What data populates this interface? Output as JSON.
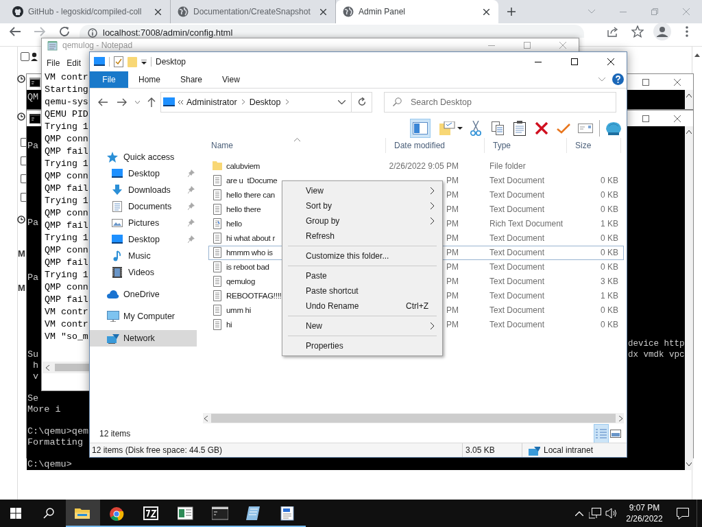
{
  "browser": {
    "tabs": [
      {
        "title": "GitHub - legoskid/compiled-coll",
        "selected": false
      },
      {
        "title": "Documentation/CreateSnapshot",
        "selected": false
      },
      {
        "title": "Admin Panel",
        "selected": true
      }
    ],
    "url": "localhost:7008/admin/config.html",
    "page_letters": [
      "M",
      "M"
    ],
    "checkboxes": [
      {
        "checked": false
      },
      {
        "checked": false
      },
      {
        "checked": false
      },
      {
        "checked": false
      },
      {
        "checked": false
      }
    ]
  },
  "console_back": {
    "lines": [
      "QM"
    ]
  },
  "console_front": {
    "groups": [
      [
        "Pa"
      ],
      [
        "Pa"
      ],
      [
        "Pa"
      ],
      [
        "Su",
        " h",
        " v"
      ],
      [
        "Se",
        "More i"
      ],
      [
        "C:\\qemu>qem",
        "Formatting"
      ],
      [
        "C:\\qemu>"
      ]
    ],
    "tails": [
      "device http",
      "dx vmdk vpc"
    ]
  },
  "notepad": {
    "title": "qemulog - Notepad",
    "menu": [
      "File",
      "Edit"
    ],
    "lines": [
      "VM contr",
      "Starting",
      "qemu-sys",
      "QEMU PID",
      "Trying 1",
      "QMP conn",
      "QMP fail",
      "Trying 1",
      "QMP conn",
      "QMP fail",
      "Trying 1",
      "QMP conn",
      "QMP fail",
      "Trying 1",
      "QMP conn",
      "QMP fail",
      "Trying 1",
      "QMP conn",
      "QMP fail",
      "VM contr",
      "VM contr",
      "VM \"so_m"
    ]
  },
  "explorer": {
    "title": "Desktop",
    "ribbon_tabs": [
      {
        "label": "File",
        "kind": "file"
      },
      {
        "label": "Home",
        "kind": "tab"
      },
      {
        "label": "Share",
        "kind": "tab"
      },
      {
        "label": "View",
        "kind": "tab"
      }
    ],
    "path": [
      "Administrator",
      "Desktop"
    ],
    "search": {
      "placeholder": "Search Desktop"
    },
    "nav": [
      {
        "label": "Quick access",
        "kind": "star",
        "selected": false,
        "children": [
          {
            "label": "Desktop",
            "kind": "desktop",
            "pinned": true,
            "selected": false
          },
          {
            "label": "Downloads",
            "kind": "downloads",
            "pinned": true,
            "selected": false
          },
          {
            "label": "Documents",
            "kind": "documents",
            "pinned": true,
            "selected": false
          },
          {
            "label": "Pictures",
            "kind": "pictures",
            "pinned": true,
            "selected": false
          },
          {
            "label": "Desktop",
            "kind": "desktop",
            "pinned": true,
            "selected": false
          },
          {
            "label": "Music",
            "kind": "music",
            "pinned": false,
            "selected": false
          },
          {
            "label": "Videos",
            "kind": "videos",
            "pinned": false,
            "selected": false
          }
        ]
      },
      {
        "label": "OneDrive",
        "kind": "cloud",
        "selected": false
      },
      {
        "label": "My Computer",
        "kind": "computer",
        "selected": false
      },
      {
        "label": "Network",
        "kind": "network",
        "selected": true
      }
    ],
    "columns": [
      "Name",
      "Date modified",
      "Type",
      "Size"
    ],
    "files": [
      {
        "name": "calubviem",
        "kind": "folder",
        "date": "2/26/2022 9:05 PM",
        "type": "File folder",
        "focused": false
      },
      {
        "name": "are u  tDocume",
        "kind": "text",
        "date": "PM",
        "type": "Text Document",
        "size": "0 KB",
        "focused": false
      },
      {
        "name": "hello there can",
        "kind": "text",
        "date": "PM",
        "type": "Text Document",
        "size": "0 KB",
        "focused": false
      },
      {
        "name": "hello there",
        "kind": "text",
        "date": "PM",
        "type": "Text Document",
        "size": "0 KB",
        "focused": false
      },
      {
        "name": "hello",
        "kind": "rich",
        "date": "PM",
        "type": "Rich Text Document",
        "size": "1 KB",
        "focused": false
      },
      {
        "name": "hi what about r",
        "kind": "text",
        "date": "PM",
        "type": "Text Document",
        "size": "0 KB",
        "focused": false
      },
      {
        "name": "hmmm who is",
        "kind": "text",
        "date": "PM",
        "type": "Text Document",
        "size": "0 KB",
        "focused": true
      },
      {
        "name": "is reboot bad",
        "kind": "text",
        "date": "PM",
        "type": "Text Document",
        "size": "0 KB",
        "focused": false
      },
      {
        "name": "qemulog",
        "kind": "text",
        "date": "PM",
        "type": "Text Document",
        "size": "3 KB",
        "focused": false
      },
      {
        "name": "REBOOTFAG!!!!",
        "kind": "text",
        "date": "PM",
        "type": "Text Document",
        "size": "1 KB",
        "focused": false
      },
      {
        "name": "umm hi",
        "kind": "text",
        "date": "PM",
        "type": "Text Document",
        "size": "0 KB",
        "focused": false
      },
      {
        "name": "hi",
        "kind": "text",
        "date": "PM",
        "type": "Text Document",
        "size": "0 KB",
        "focused": false
      }
    ],
    "item_count": "12 items",
    "status": {
      "summary": "12 items (Disk free space: 44.5 GB)",
      "size": "3.05 KB",
      "zone": "Local intranet"
    },
    "context_menu": [
      {
        "kind": "item",
        "label": "View",
        "submenu": true
      },
      {
        "kind": "item",
        "label": "Sort by",
        "submenu": true
      },
      {
        "kind": "item",
        "label": "Group by",
        "submenu": true
      },
      {
        "kind": "item",
        "label": "Refresh",
        "submenu": false
      },
      {
        "kind": "separator"
      },
      {
        "kind": "item",
        "label": "Customize this folder...",
        "submenu": false
      },
      {
        "kind": "separator"
      },
      {
        "kind": "item",
        "label": "Paste",
        "submenu": false
      },
      {
        "kind": "item",
        "label": "Paste shortcut",
        "submenu": false
      },
      {
        "kind": "item",
        "label": "Undo Rename",
        "shortcut": "Ctrl+Z",
        "submenu": false
      },
      {
        "kind": "separator"
      },
      {
        "kind": "item",
        "label": "New",
        "submenu": true
      },
      {
        "kind": "separator"
      },
      {
        "kind": "item",
        "label": "Properties",
        "submenu": false
      }
    ]
  },
  "taskbar": {
    "apps": [
      {
        "kind": "explorer",
        "active": true,
        "running": true
      },
      {
        "kind": "chrome",
        "active": false,
        "running": true
      },
      {
        "kind": "sevenzip",
        "active": false,
        "running": true
      },
      {
        "kind": "sheet",
        "active": false,
        "running": true
      },
      {
        "kind": "console",
        "active": false,
        "running": true
      },
      {
        "kind": "notepad",
        "active": false,
        "running": true
      },
      {
        "kind": "wordpad",
        "active": false,
        "running": true
      }
    ],
    "clock": {
      "time": "9:07 PM",
      "date": "2/26/2022"
    }
  }
}
